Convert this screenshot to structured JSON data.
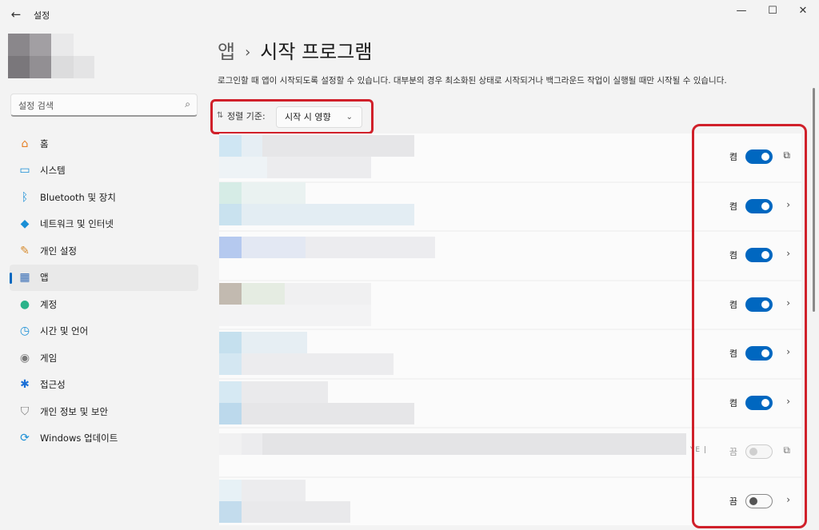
{
  "window": {
    "title": "설정",
    "back_glyph": "←",
    "controls": {
      "minimize": "—",
      "maximize": "☐",
      "close": "✕"
    }
  },
  "search": {
    "placeholder": "설정 검색",
    "icon": "search-icon",
    "glyph": "⌕"
  },
  "nav": {
    "items": [
      {
        "label": "홈",
        "icon": "home-icon",
        "glyph": "⌂",
        "color": "#e67e22"
      },
      {
        "label": "시스템",
        "icon": "system-icon",
        "glyph": "▭",
        "color": "#1a8fd6"
      },
      {
        "label": "Bluetooth 및 장치",
        "icon": "bluetooth-icon",
        "glyph": "ᛒ",
        "color": "#1a8fd6"
      },
      {
        "label": "네트워크 및 인터넷",
        "icon": "wifi-icon",
        "glyph": "◆",
        "color": "#1a8fd6"
      },
      {
        "label": "개인 설정",
        "icon": "brush-icon",
        "glyph": "✎",
        "color": "#d68a2c"
      },
      {
        "label": "앱",
        "icon": "apps-icon",
        "glyph": "▦",
        "color": "#3a6fb7"
      },
      {
        "label": "계정",
        "icon": "account-icon",
        "glyph": "●",
        "color": "#2bb38a"
      },
      {
        "label": "시간 및 언어",
        "icon": "globe-clock-icon",
        "glyph": "◷",
        "color": "#1a8fd6"
      },
      {
        "label": "게임",
        "icon": "gamepad-icon",
        "glyph": "◉",
        "color": "#7a7a7a"
      },
      {
        "label": "접근성",
        "icon": "accessibility-icon",
        "glyph": "✱",
        "color": "#1a6fd6"
      },
      {
        "label": "개인 정보 및 보안",
        "icon": "shield-icon",
        "glyph": "⛉",
        "color": "#7a7a7a"
      },
      {
        "label": "Windows 업데이트",
        "icon": "update-icon",
        "glyph": "⟳",
        "color": "#1a8fd6"
      }
    ],
    "active_index": 5
  },
  "breadcrumb": {
    "parent": "앱",
    "separator": "›",
    "current": "시작 프로그램"
  },
  "description": "로그인할 때 앱이 시작되도록 설정할 수 있습니다. 대부분의 경우 최소화된 상태로 시작되거나 백그라운드 작업이 실행될 때만 시작될 수 있습니다.",
  "sort": {
    "icon": "sort-icon",
    "glyph": "⇅",
    "label": "정렬 기준:",
    "selected": "시작 시 영향",
    "chevron": "⌄"
  },
  "apps": [
    {
      "state_label": "켬",
      "on": true,
      "action": "external-link-icon",
      "action_glyph": "⧉",
      "trail": ""
    },
    {
      "state_label": "켬",
      "on": true,
      "action": "chevron-right-icon",
      "action_glyph": "›",
      "trail": ""
    },
    {
      "state_label": "켬",
      "on": true,
      "action": "chevron-right-icon",
      "action_glyph": "›",
      "trail": ""
    },
    {
      "state_label": "켬",
      "on": true,
      "action": "chevron-right-icon",
      "action_glyph": "›",
      "trail": ""
    },
    {
      "state_label": "켬",
      "on": true,
      "action": "chevron-right-icon",
      "action_glyph": "›",
      "trail": ""
    },
    {
      "state_label": "켬",
      "on": true,
      "action": "chevron-right-icon",
      "action_glyph": "›",
      "trail": ""
    },
    {
      "state_label": "끔",
      "on": false,
      "disabled": true,
      "action": "external-link-icon",
      "action_glyph": "⧉",
      "trail": "YE |"
    },
    {
      "state_label": "끔",
      "on": false,
      "action": "chevron-right-icon",
      "action_glyph": "›",
      "trail": ""
    }
  ],
  "colors": {
    "accent": "#0067c0",
    "highlight_box": "#d0202a"
  }
}
